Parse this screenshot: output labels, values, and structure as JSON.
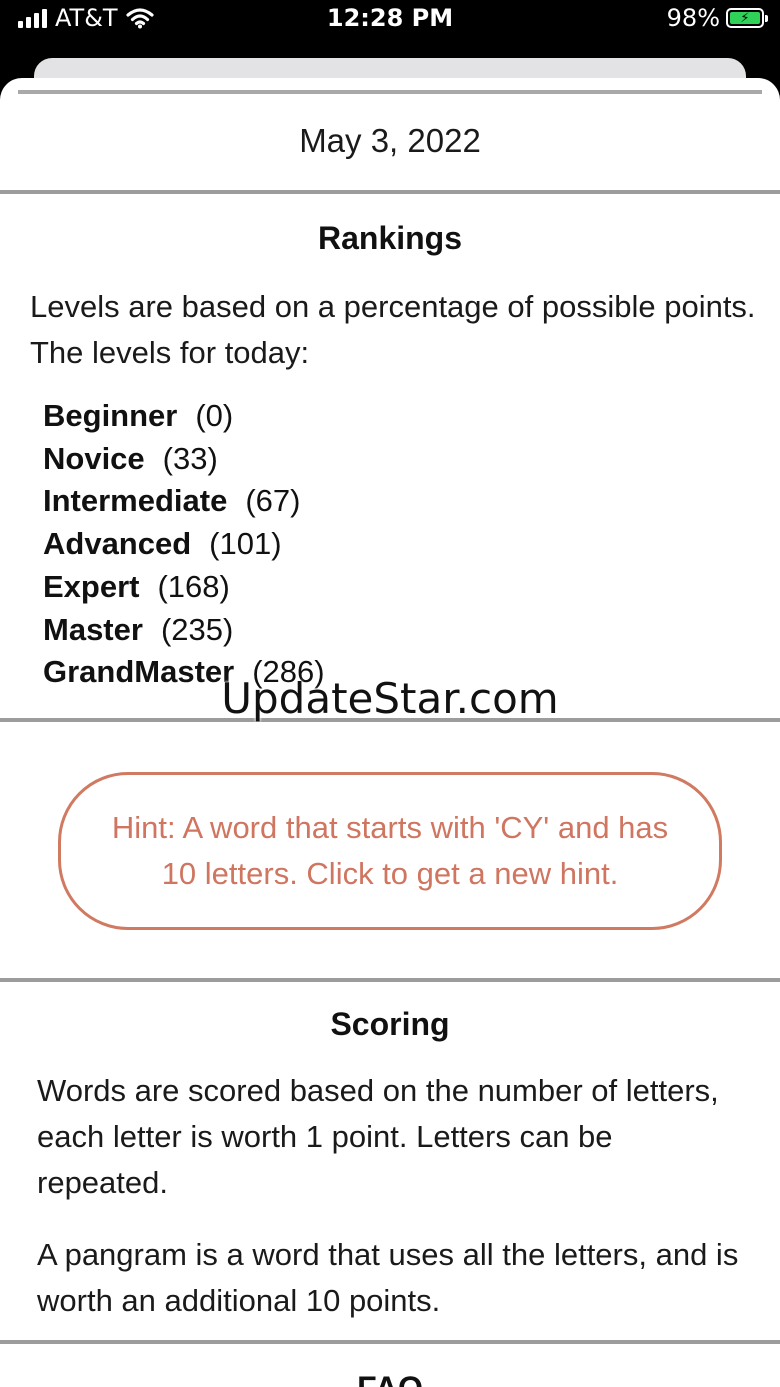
{
  "status_bar": {
    "carrier": "AT&T",
    "time": "12:28 PM",
    "battery_percent": "98%",
    "icons": [
      "signal-icon",
      "wifi-icon",
      "battery-charging-icon"
    ]
  },
  "date": "May 3, 2022",
  "rankings": {
    "title": "Rankings",
    "description": "Levels are based on a percentage of possible points. The levels for today:",
    "levels": [
      {
        "name": "Beginner",
        "value": "(0)"
      },
      {
        "name": "Novice",
        "value": "(33)"
      },
      {
        "name": "Intermediate",
        "value": "(67)"
      },
      {
        "name": "Advanced",
        "value": "(101)"
      },
      {
        "name": "Expert",
        "value": "(168)"
      },
      {
        "name": "Master",
        "value": "(235)"
      },
      {
        "name": "GrandMaster",
        "value": "(286)"
      }
    ]
  },
  "watermark": "UpdateStar.com",
  "hint": {
    "text": "Hint: A word that starts with 'CY' and has 10 letters. Click to get a new hint.",
    "color": "#cf7560"
  },
  "scoring": {
    "title": "Scoring",
    "paragraph1": "Words are scored based on the number of letters, each letter is worth 1 point. Letters can be repeated.",
    "paragraph2": "A pangram is a word that uses all the letters, and is worth an additional 10 points."
  },
  "faq": {
    "title": "FAQ"
  }
}
